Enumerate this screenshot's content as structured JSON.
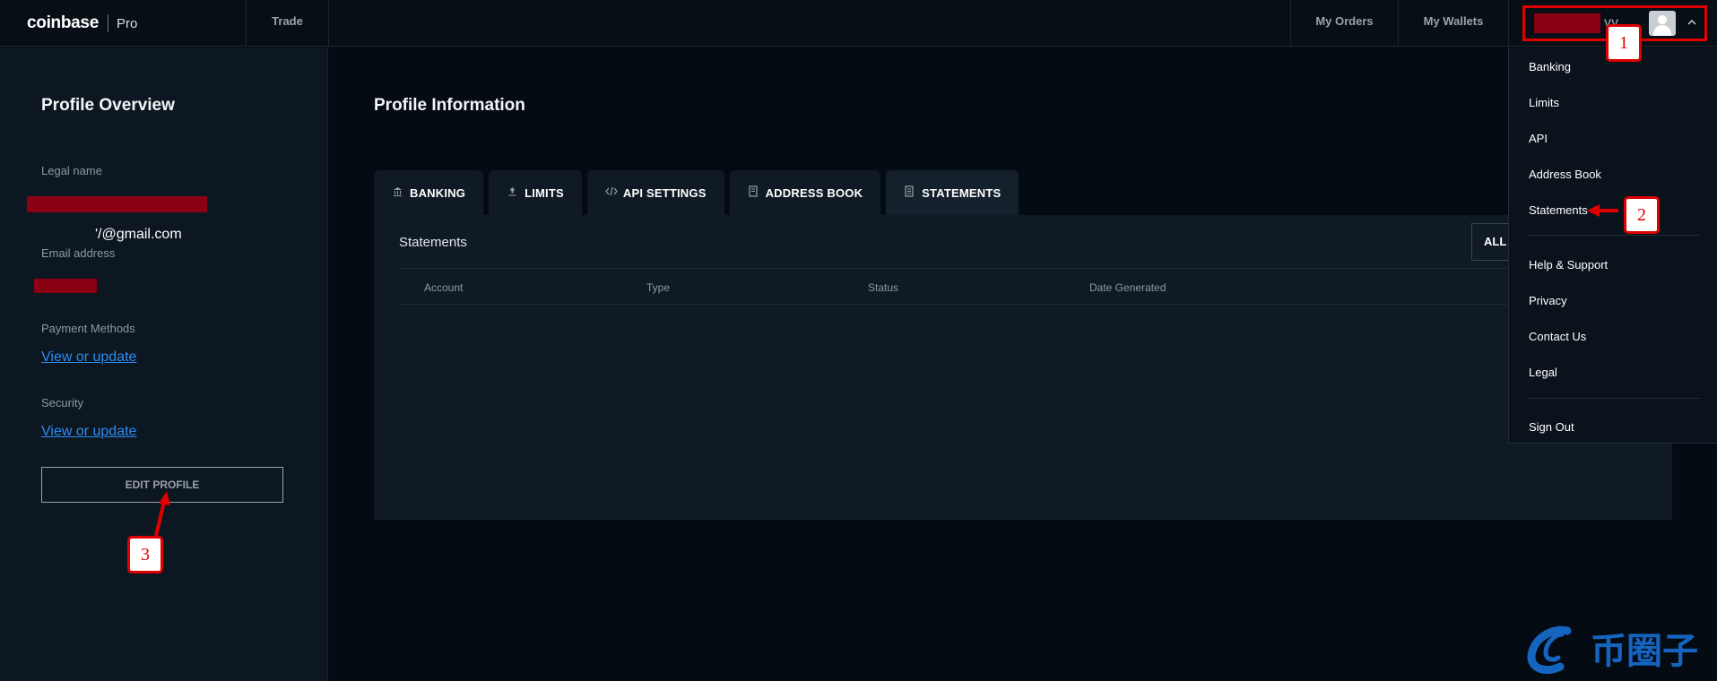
{
  "app": {
    "logo_main": "coinbase",
    "logo_sub": "Pro"
  },
  "nav": {
    "trade": "Trade",
    "my_orders": "My Orders",
    "my_wallets": "My Wallets"
  },
  "user": {
    "name_tail": "VV...",
    "menu_caret": "^"
  },
  "profile_overview": {
    "title": "Profile Overview",
    "legal_name_label": "Legal name",
    "email_label": "Email address",
    "email_suffix": "'/@gmail.com",
    "payment_label": "Payment Methods",
    "payment_link": "View or update",
    "security_label": "Security",
    "security_link": "View or update",
    "edit_button": "EDIT PROFILE"
  },
  "profile_information": {
    "title": "Profile Information",
    "tabs": [
      {
        "label": "BANKING",
        "icon": "bank-icon"
      },
      {
        "label": "LIMITS",
        "icon": "upload-icon"
      },
      {
        "label": "API SETTINGS",
        "icon": "code-icon"
      },
      {
        "label": "ADDRESS BOOK",
        "icon": "address-book-icon"
      },
      {
        "label": "STATEMENTS",
        "icon": "document-icon"
      }
    ],
    "active_tab": "STATEMENTS",
    "card_title": "Statements",
    "filter_button": "ALL",
    "columns": [
      "Account",
      "Type",
      "Status",
      "Date Generated"
    ]
  },
  "dropdown": {
    "group1": [
      "Banking",
      "Limits",
      "API",
      "Address Book",
      "Statements"
    ],
    "group2": [
      "Help & Support",
      "Privacy",
      "Contact Us",
      "Legal"
    ],
    "sign_out": "Sign Out"
  },
  "annotations": [
    "1",
    "2",
    "3"
  ],
  "watermark": {
    "text": "币圈子"
  },
  "colors": {
    "background": "#050b13",
    "panel": "#0d1721",
    "card": "#0f1a25",
    "link": "#2d8cf0",
    "annotation_red": "#e00000",
    "redaction": "#8b0012",
    "watermark_blue": "#1565c0"
  }
}
